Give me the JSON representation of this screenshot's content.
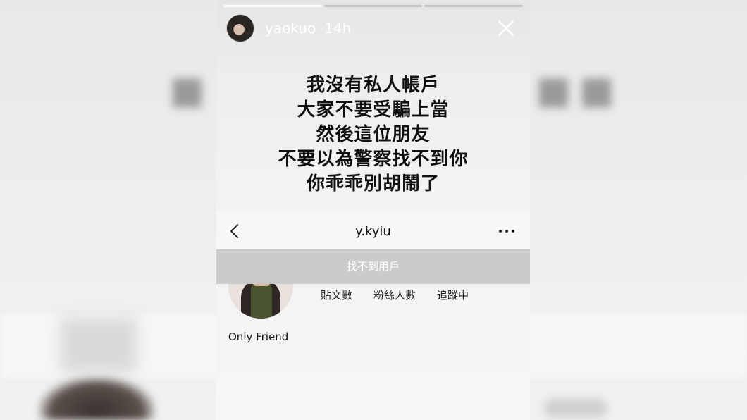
{
  "story": {
    "username": "yaokuo",
    "time": "14h",
    "progress": [
      1,
      0,
      0
    ],
    "message_lines": [
      "我沒有私人帳戶",
      "大家不要受騙上當",
      "然後這位朋友",
      "不要以為警察找不到你",
      "你乖乖別胡鬧了"
    ]
  },
  "screenshot": {
    "profile_name": "y.kyiu",
    "toast": "找不到用戶",
    "stats": [
      "貼文數",
      "粉絲人數",
      "追蹤中"
    ],
    "bio_name": "Only Friend"
  },
  "icons": {
    "close": "close-icon",
    "back": "chevron-left-icon",
    "more": "more-horizontal-icon"
  }
}
